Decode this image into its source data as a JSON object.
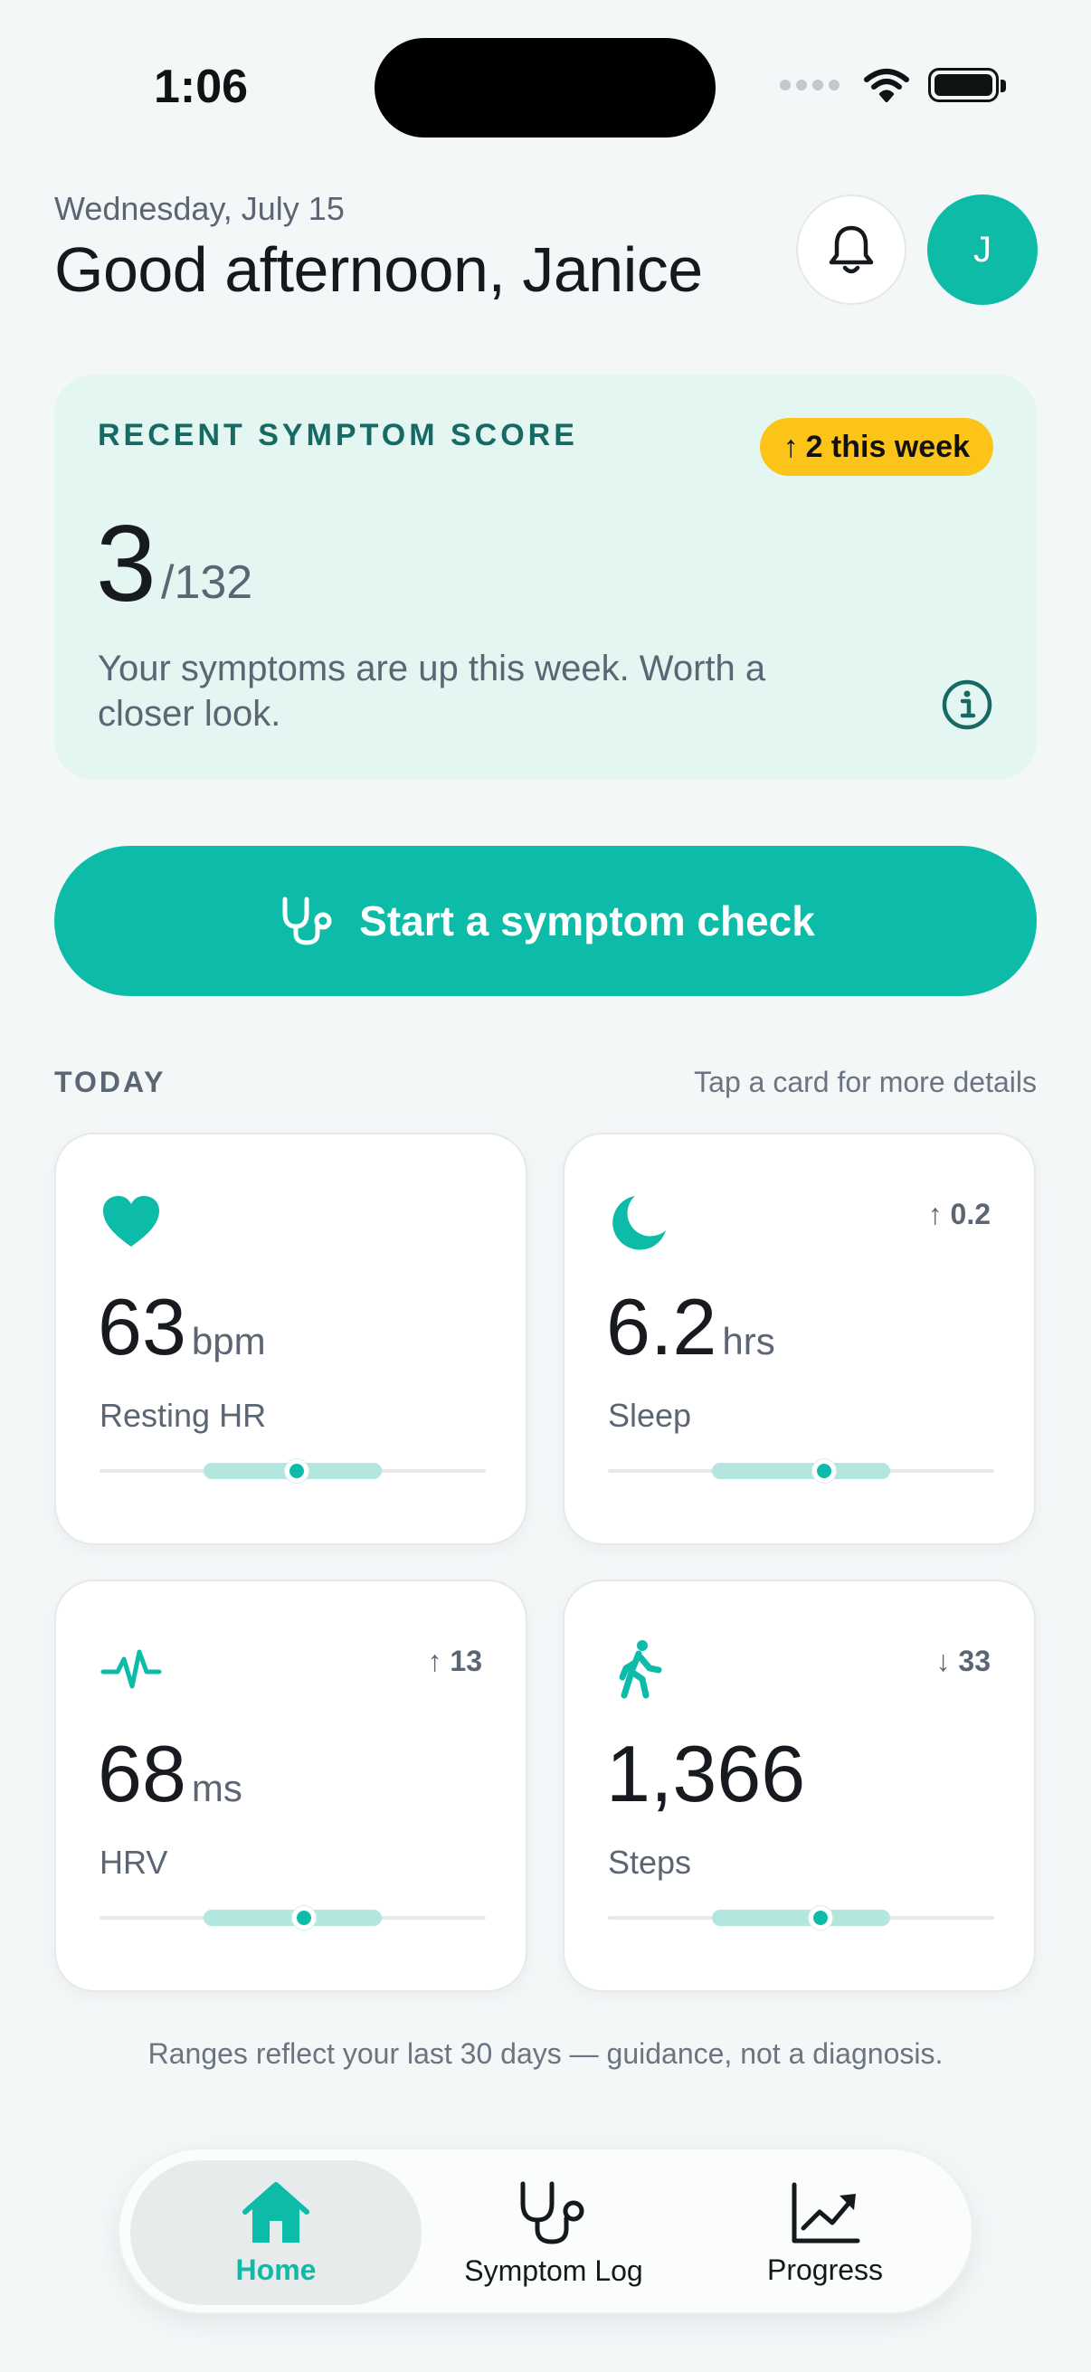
{
  "status_bar": {
    "time": "1:06"
  },
  "header": {
    "date": "Wednesday, July 15",
    "greeting": "Good afternoon, Janice",
    "avatar_initial": "J"
  },
  "score_card": {
    "label": "RECENT SYMPTOM SCORE",
    "badge_arrow": "↑",
    "badge": "2 this week",
    "value": "3",
    "total": "/132",
    "message": "Your symptoms are up this week. Worth a closer look."
  },
  "cta": {
    "label": "Start a symptom check"
  },
  "today": {
    "label": "TODAY",
    "hint": "Tap a card for more details"
  },
  "metrics": [
    {
      "icon": "heart-icon",
      "value": "63",
      "unit": "bpm",
      "label": "Resting HR",
      "delta": "",
      "range_band": [
        0.27,
        0.73
      ],
      "marker": 0.51
    },
    {
      "icon": "moon-icon",
      "value": "6.2",
      "unit": "hrs",
      "label": "Sleep",
      "delta": "↑ 0.2",
      "range_band": [
        0.27,
        0.73
      ],
      "marker": 0.56
    },
    {
      "icon": "pulse-icon",
      "value": "68",
      "unit": "ms",
      "label": "HRV",
      "delta": "↑ 13",
      "range_band": [
        0.27,
        0.73
      ],
      "marker": 0.53
    },
    {
      "icon": "walking-icon",
      "value": "1,366",
      "unit": "",
      "label": "Steps",
      "delta": "↓ 33",
      "range_band": [
        0.27,
        0.73
      ],
      "marker": 0.55
    }
  ],
  "disclaimer": "Ranges reflect your last 30 days — guidance, not a diagnosis.",
  "nav": {
    "home": "Home",
    "log": "Symptom Log",
    "progress": "Progress"
  },
  "colors": {
    "accent": "#0cbba8",
    "badge": "#fcc419",
    "score_card_bg": "#e4f6f2"
  }
}
